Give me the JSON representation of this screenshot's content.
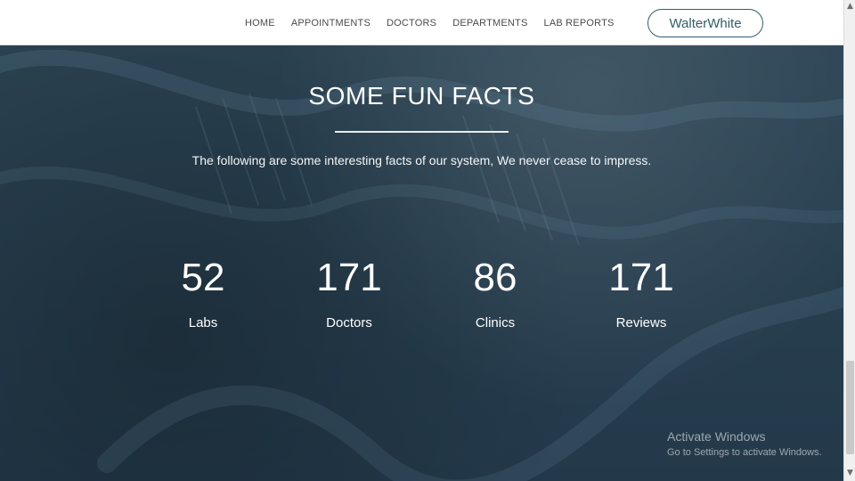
{
  "nav": {
    "items": [
      "HOME",
      "APPOINTMENTS",
      "DOCTORS",
      "DEPARTMENTS",
      "LAB REPORTS"
    ]
  },
  "user": {
    "name": "WalterWhite"
  },
  "hero": {
    "title": "SOME FUN FACTS",
    "subtitle": "The following are some interesting facts of our system, We never cease to impress."
  },
  "stats": [
    {
      "value": "52",
      "label": "Labs"
    },
    {
      "value": "171",
      "label": "Doctors"
    },
    {
      "value": "86",
      "label": "Clinics"
    },
    {
      "value": "171",
      "label": "Reviews"
    }
  ],
  "windows_activation": {
    "title": "Activate Windows",
    "subtitle": "Go to Settings to activate Windows."
  }
}
